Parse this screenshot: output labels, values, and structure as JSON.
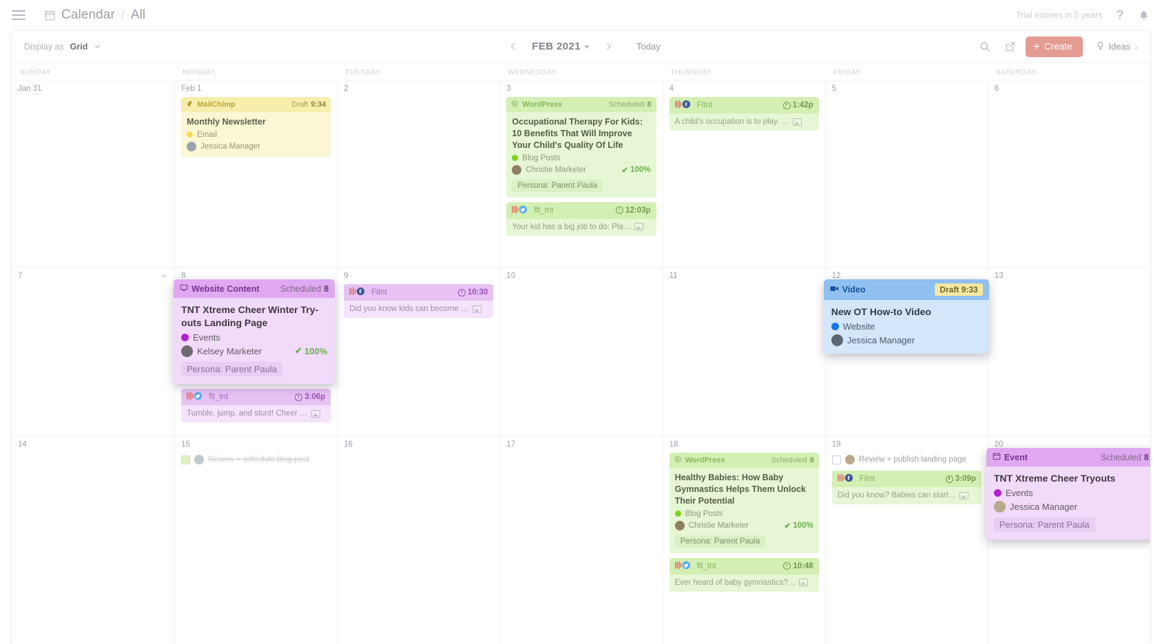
{
  "header": {
    "menu_icon": "hamburger-icon",
    "calendar_icon": "calendar-icon",
    "title": "Calendar",
    "separator": "/",
    "view_name": "All",
    "trial_text": "Trial expires in 5 years",
    "help_icon": "?",
    "bell_icon": "notification-bell-icon"
  },
  "toolbar": {
    "display_label": "Display as",
    "display_value": "Grid",
    "prev_label": "‹",
    "next_label": "›",
    "month_label": "FEB 2021",
    "today_label": "Today",
    "search_icon": "search-icon",
    "share_icon": "share-icon",
    "create_label": "Create",
    "create_color": "#e49b92",
    "ideas_label": "Ideas",
    "ideas_icon": "lightbulb-icon"
  },
  "weekdays": [
    "SUNDAY",
    "MONDAY",
    "TUESDAY",
    "WEDNESDAY",
    "THURSDAY",
    "FRIDAY",
    "SATURDAY"
  ],
  "weeks": [
    {
      "days": [
        {
          "num": "Jan 31"
        },
        {
          "num": "Feb 1"
        },
        {
          "num": "2"
        },
        {
          "num": "3"
        },
        {
          "num": "4"
        },
        {
          "num": "5"
        },
        {
          "num": "6"
        }
      ]
    },
    {
      "days": [
        {
          "num": "7"
        },
        {
          "num": "8"
        },
        {
          "num": "9"
        },
        {
          "num": "10"
        },
        {
          "num": "11"
        },
        {
          "num": "12"
        },
        {
          "num": "13"
        }
      ]
    },
    {
      "days": [
        {
          "num": "14"
        },
        {
          "num": "15"
        },
        {
          "num": "16"
        },
        {
          "num": "17"
        },
        {
          "num": "18"
        },
        {
          "num": "19"
        },
        {
          "num": "20"
        }
      ]
    }
  ],
  "cards": {
    "mailchimp": {
      "channel": "MailChimp",
      "status": "Draft",
      "time": "9:34",
      "title": "Monthly Newsletter",
      "category": "Email",
      "category_color": "#f2dd55",
      "author": "Jessica Manager"
    },
    "wordpress_ot": {
      "channel": "WordPress",
      "status": "Scheduled",
      "count": "8",
      "title": "Occupational Therapy For Kids: 10 Benefits That Will Improve Your Child's Quality Of Life",
      "category": "Blog Posts",
      "category_color": "#7ed321",
      "author": "Christie Marketer",
      "percent": "100%",
      "tag": "Persona: Parent Paula"
    },
    "twitter_feb3": {
      "channel": "flt_tnt",
      "time": "12:03p",
      "text": "Your kid has a big job to do: Pla…"
    },
    "facebook_feb4": {
      "channel": "Fitnt",
      "time": "1:42p",
      "text": "A child's occupation is to play. …"
    },
    "website_content": {
      "channel": "Website Content",
      "status": "Scheduled",
      "count": "8",
      "title": "TNT Xtreme Cheer Winter Try-outs Landing Page",
      "category": "Events",
      "category_color": "#b31fd4",
      "author": "Kelsey Marketer",
      "percent": "100%",
      "tag": "Persona: Parent Paula"
    },
    "facebook_feb9": {
      "channel": "Fitnt",
      "time": "10:30",
      "text": "Did you know kids can become …"
    },
    "twitter_feb8": {
      "channel": "flt_tnt",
      "time": "3:06p",
      "text": "Tumble, jump, and stunt! Cheer …"
    },
    "video_feb12": {
      "channel": "Video",
      "status": "Draft",
      "time": "9:33",
      "title": "New OT How-to Video",
      "category": "Website",
      "category_color": "#1a73e8",
      "author": "Jessica Manager"
    },
    "task_feb15": {
      "label": "Review + schedule blog post",
      "checked": true
    },
    "wordpress_babies": {
      "channel": "WordPress",
      "status": "Scheduled",
      "count": "8",
      "title": "Healthy Babies: How Baby Gymnastics Helps Them Unlock Their Potential",
      "category": "Blog Posts",
      "category_color": "#7ed321",
      "author": "Christie Marketer",
      "percent": "100%",
      "tag": "Persona: Parent Paula"
    },
    "twitter_feb18": {
      "channel": "flt_tnt",
      "time": "10:48",
      "text": "Ever heard of baby gymnastics?…"
    },
    "task_feb19": {
      "label": "Review + publish landing page",
      "checked": false
    },
    "facebook_feb19": {
      "channel": "Fitnt",
      "time": "3:09p",
      "text": "Did you know? Babies can start…"
    },
    "event_feb20": {
      "channel": "Event",
      "status": "Scheduled",
      "count": "8",
      "title": "TNT Xtreme Cheer Tryouts",
      "category": "Events",
      "category_color": "#b31fd4",
      "author": "Jessica Manager",
      "tag": "Persona: Parent Paula"
    }
  }
}
